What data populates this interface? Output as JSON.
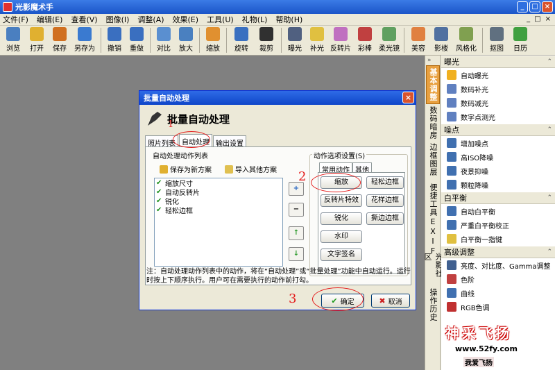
{
  "app": {
    "title": "光影魔术手"
  },
  "menu": [
    "文件(F)",
    "编辑(E)",
    "查看(V)",
    "图像(I)",
    "调整(A)",
    "效果(E)",
    "工具(U)",
    "礼物(L)",
    "帮助(H)"
  ],
  "toolbar": [
    {
      "label": "浏览",
      "icon": "browse-icon",
      "color": "#4a7fc0"
    },
    {
      "label": "打开",
      "icon": "folder-icon",
      "color": "#e0b030"
    },
    {
      "label": "保存",
      "icon": "save-icon",
      "color": "#d07020"
    },
    {
      "label": "另存为",
      "icon": "save-as-icon",
      "color": "#3a7ad0"
    },
    {
      "label": "撤销",
      "icon": "undo-icon",
      "color": "#3a6fc0"
    },
    {
      "label": "重做",
      "icon": "redo-icon",
      "color": "#3a6fc0"
    },
    {
      "label": "对比",
      "icon": "compare-icon",
      "color": "#5a8fd0"
    },
    {
      "label": "放大",
      "icon": "zoom-in-icon",
      "color": "#4a80c0"
    },
    {
      "label": "缩放",
      "icon": "resize-icon",
      "color": "#e09030"
    },
    {
      "label": "旋转",
      "icon": "rotate-icon",
      "color": "#3a70c0"
    },
    {
      "label": "裁剪",
      "icon": "crop-icon",
      "color": "#303030"
    },
    {
      "label": "曝光",
      "icon": "exposure-icon",
      "color": "#506080"
    },
    {
      "label": "补光",
      "icon": "fill-light-icon",
      "color": "#e0c040"
    },
    {
      "label": "反转片",
      "icon": "film-reverse-icon",
      "color": "#c070c0"
    },
    {
      "label": "彩棒",
      "icon": "color-stick-icon",
      "color": "#c04040"
    },
    {
      "label": "柔光镜",
      "icon": "soft-light-icon",
      "color": "#60a060"
    },
    {
      "label": "美容",
      "icon": "beauty-icon",
      "color": "#e08040"
    },
    {
      "label": "影楼",
      "icon": "studio-icon",
      "color": "#5070a0"
    },
    {
      "label": "风格化",
      "icon": "stylize-icon",
      "color": "#80a050"
    },
    {
      "label": "抠图",
      "icon": "cutout-icon",
      "color": "#607080"
    },
    {
      "label": "日历",
      "icon": "calendar-icon",
      "color": "#40a040"
    }
  ],
  "right_tabs": [
    "基本调整",
    "数码暗房",
    "边框图层",
    "便捷工具",
    "EXIF",
    "光影社区",
    "操作历史"
  ],
  "panel": [
    {
      "header": "曝光",
      "items": [
        {
          "label": "自动曝光",
          "color": "#f0b020"
        },
        {
          "label": "数码补光",
          "color": "#6080c0"
        },
        {
          "label": "数码减光",
          "color": "#6080c0"
        },
        {
          "label": "数字点测光",
          "color": "#6080c0"
        }
      ]
    },
    {
      "header": "噪点",
      "items": [
        {
          "label": "增加噪点",
          "color": "#4070b0"
        },
        {
          "label": "高ISO降噪",
          "color": "#4070b0"
        },
        {
          "label": "夜景抑噪",
          "color": "#4070b0"
        },
        {
          "label": "颗粒降噪",
          "color": "#4070b0"
        }
      ]
    },
    {
      "header": "白平衡",
      "items": [
        {
          "label": "自动白平衡",
          "color": "#4070b0"
        },
        {
          "label": "严重白平衡校正",
          "color": "#4070b0"
        },
        {
          "label": "白平衡一指键",
          "color": "#e0c040"
        }
      ]
    },
    {
      "header": "高级调整",
      "items": [
        {
          "label": "亮度、对比度、Gamma调整",
          "color": "#406090"
        },
        {
          "label": "色阶",
          "color": "#c04040"
        },
        {
          "label": "曲线",
          "color": "#4070b0"
        },
        {
          "label": "RGB色调",
          "color": "#c03030"
        }
      ]
    }
  ],
  "dialog": {
    "title": "批量自动处理",
    "header": "批量自动处理",
    "tabs": [
      "照片列表",
      "自动处理",
      "输出设置"
    ],
    "list_group_label": "自动处理动作列表",
    "save_scheme": "保存为新方案",
    "import_scheme": "导入其他方案",
    "actions": [
      "缩放尺寸",
      "自动反转片",
      "锐化",
      "轻松边框"
    ],
    "side_buttons": [
      "+",
      "−",
      "↑",
      "↓"
    ],
    "options_label": "动作选项设置(S)",
    "sub_tabs": [
      "常用动作",
      "其他"
    ],
    "action_buttons": [
      "缩放",
      "轻松边框",
      "反转片特效",
      "花样边框",
      "锐化",
      "撕边边框",
      "水印",
      "文字签名"
    ],
    "note": "注：自动处理动作列表中的动作，将在“自动处理”或“批量处理”功能中自动运行。运行时按上下顺序执行。用户可在需要执行的动作前打勾。",
    "ok": "确定",
    "cancel": "取消"
  },
  "annotations": [
    "1",
    "2",
    "3"
  ],
  "watermark": {
    "brand": "神采飞扬",
    "url": "www.52fy.com",
    "tagline": "我爱飞扬"
  }
}
